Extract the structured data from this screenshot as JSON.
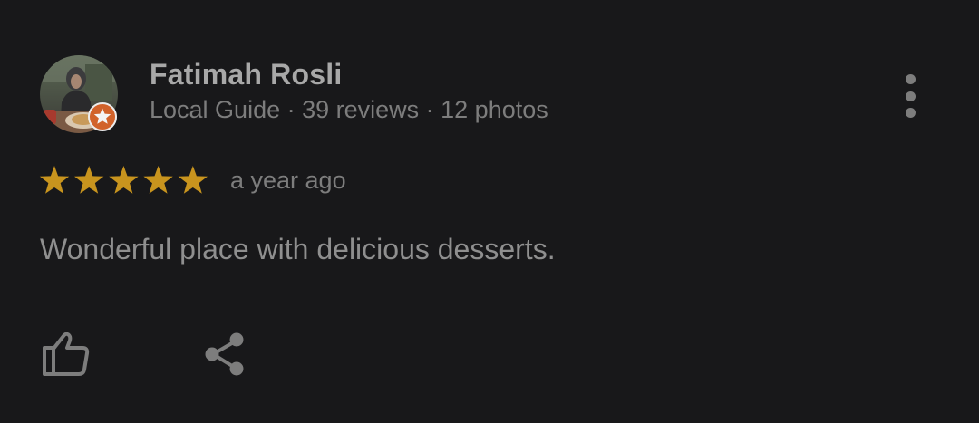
{
  "reviewer": {
    "name": "Fatimah Rosli",
    "meta": "Local Guide · 39 reviews · 12 photos",
    "avatar_icon": "profile-photo",
    "badge_icon": "local-guide-star-badge"
  },
  "review": {
    "rating": 5,
    "rating_max": 5,
    "time": "a year ago",
    "text": "Wonderful place with delicious desserts."
  },
  "actions": {
    "more_icon": "more-vert-icon",
    "like_icon": "thumb-up-icon",
    "share_icon": "share-icon"
  },
  "colors": {
    "background": "#18181a",
    "star": "#c8941e",
    "badge": "#d1622a",
    "icon": "#7d7d7d"
  }
}
